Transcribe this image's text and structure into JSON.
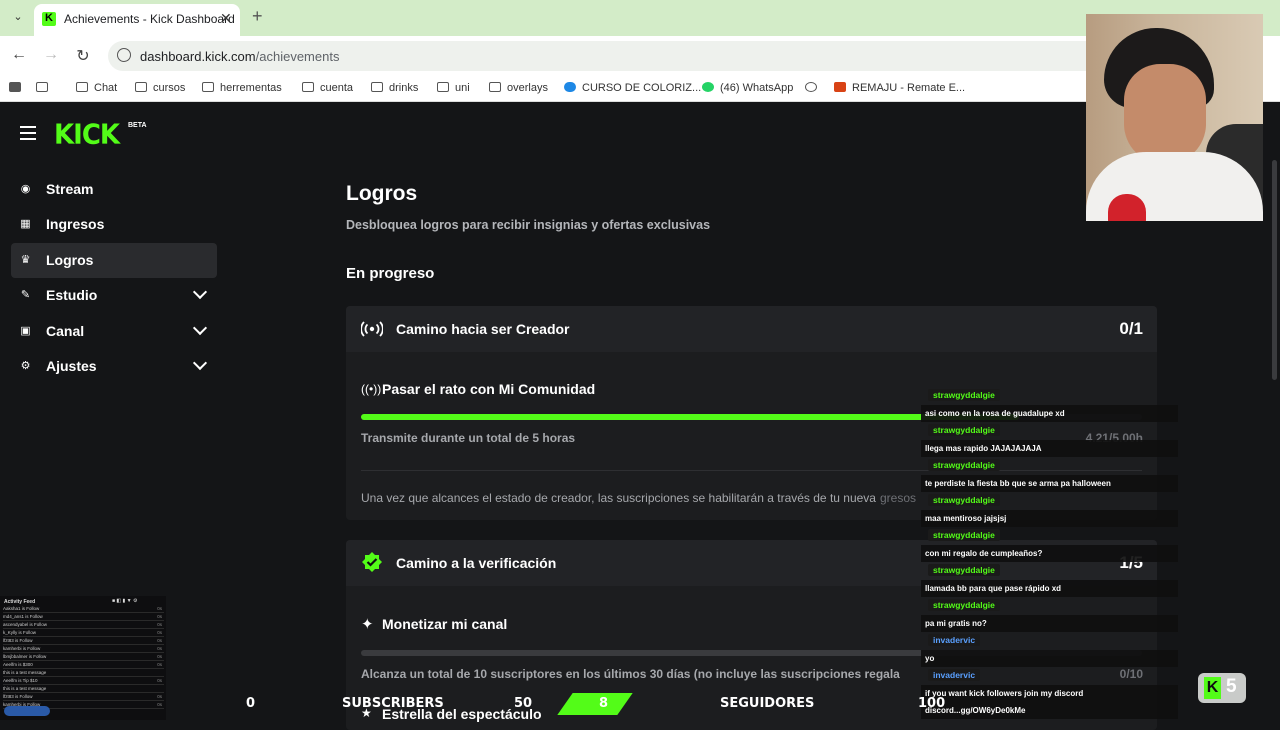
{
  "browser": {
    "tab_title": "Achievements - Kick Dashboard",
    "url_domain": "dashboard.kick.com",
    "url_path": "/achievements",
    "bookmarks": [
      "Chat",
      "cursos",
      "herrementas",
      "cuenta",
      "drinks",
      "uni",
      "overlays",
      "CURSO DE COLORIZ...",
      "(46) WhatsApp",
      "REMAJU - Remate E..."
    ]
  },
  "app": {
    "logo": "KICK",
    "logo_badge": "BETA",
    "sidebar": [
      {
        "label": "Stream",
        "icon": "stream-icon"
      },
      {
        "label": "Ingresos",
        "icon": "chart-icon"
      },
      {
        "label": "Logros",
        "icon": "trophy-icon",
        "active": true
      },
      {
        "label": "Estudio",
        "icon": "studio-icon",
        "expandable": true
      },
      {
        "label": "Canal",
        "icon": "channel-icon",
        "expandable": true
      },
      {
        "label": "Ajustes",
        "icon": "gear-icon",
        "expandable": true
      }
    ]
  },
  "main": {
    "title": "Logros",
    "subtitle": "Desbloquea logros para recibir insignias y ofertas exclusivas",
    "section": "En progreso",
    "cards": [
      {
        "title": "Camino hacia ser Creador",
        "count": "0/1",
        "task": "Pasar el rato con Mi Comunidad",
        "progress": 0.842,
        "desc": "Transmite durante un total de 5 horas",
        "value": "4.21/5.00h",
        "note": "Una vez que alcances el estado de creador, las suscripciones se habilitarán a través de tu nueva",
        "note_tail": "gresos"
      },
      {
        "title": "Camino a la verificación",
        "count": "1/5",
        "task": "Monetizar mi canal",
        "progress": 0.0,
        "desc": "Alcanza un total de 10 suscriptores en los últimos 30 días (no incluye las suscripciones regala",
        "value": "0/10",
        "next_task": "Estrella del espectáculo"
      }
    ]
  },
  "chat": [
    {
      "user": "strawgyddalgie",
      "text": "asi como en la rosa de guadalupe xd"
    },
    {
      "user": "strawgyddalgie",
      "text": "llega mas rapido JAJAJAJAJA"
    },
    {
      "user": "strawgyddalgie",
      "text": "te perdiste la fiesta bb que se arma pa halloween"
    },
    {
      "user": "strawgyddalgie",
      "text": "maa mentiroso jajsjsj"
    },
    {
      "user": "strawgyddalgie",
      "text": "con mi regalo de cumpleaños?"
    },
    {
      "user": "strawgyddalgie",
      "text": "llamada bb para que pase rápido xd"
    },
    {
      "user": "strawgyddalgie",
      "text": "pa mi gratis no?"
    },
    {
      "user": "invadervic",
      "text": "yo"
    },
    {
      "user": "invadervic",
      "text": "if you want kick followers join my discord"
    },
    {
      "user": "",
      "text": "discord...gg/OW6yDe0kMe"
    }
  ],
  "feed": {
    "title": "Activity Feed",
    "rows": [
      {
        "name": "Aaksha1 is Follow",
        "val": "0s"
      },
      {
        "name": "md4_ans1 is Follow",
        "val": "0s"
      },
      {
        "name": "ascendyabel is Follow",
        "val": "0s"
      },
      {
        "name": "k_Kylly is Follow",
        "val": "0s"
      },
      {
        "name": "lfzt83 is Follow",
        "val": "0s"
      },
      {
        "name": "kamherbi is Follow",
        "val": "0s"
      },
      {
        "name": "lbmjbbalmer is Follow",
        "val": "0s"
      },
      {
        "name": "Aeelfm is $300",
        "val": "0s"
      },
      {
        "name": "this is a test message",
        "val": ""
      },
      {
        "name": "Aeelfm is Tip $10",
        "val": "0s"
      },
      {
        "name": "this is a test message",
        "val": ""
      },
      {
        "name": "lfzt83 is Follow",
        "val": "0s"
      },
      {
        "name": "kamherbi is Follow",
        "val": "0s"
      }
    ]
  },
  "goal_bar": {
    "left_value": "0",
    "left_label": "SUBSCRIBERS",
    "left_target": "50",
    "right_value": "8",
    "right_label": "SEGUIDORES",
    "right_target": "100"
  },
  "kick_badge": "5",
  "colors": {
    "accent": "#53fc18",
    "bg": "#141517",
    "card": "#1c1d1f"
  }
}
